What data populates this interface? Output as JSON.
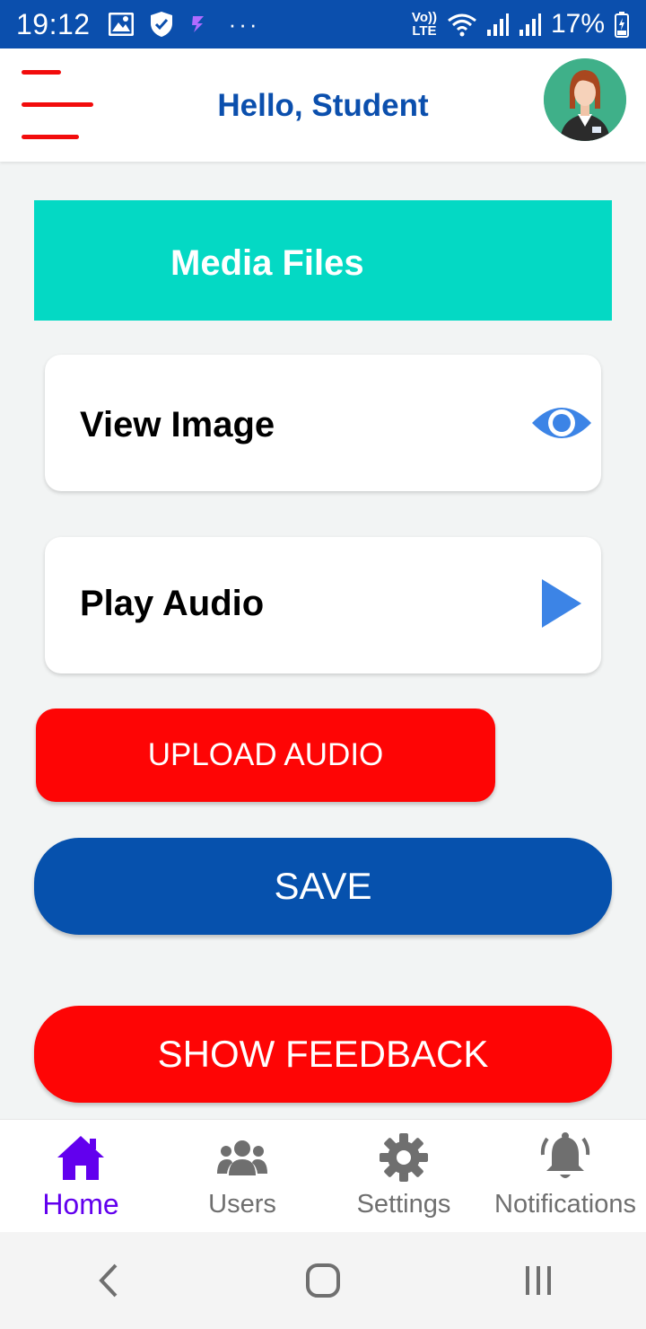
{
  "status_bar": {
    "time": "19:12",
    "network_label": "Vo)) LTE",
    "battery": "17%",
    "icons": [
      "image-icon",
      "shield-check-icon",
      "app-icon",
      "more-dots-icon",
      "wifi-icon",
      "signal-icon",
      "signal-icon",
      "battery-icon"
    ]
  },
  "header": {
    "title": "Hello, Student",
    "menu_icon": "hamburger-menu-icon",
    "avatar_icon": "student-avatar-icon",
    "accent_color": "#0b4fad"
  },
  "banner": {
    "label": "Media Files",
    "color": "#04d9c4"
  },
  "cards": [
    {
      "label": "View Image",
      "icon": "eye-icon"
    },
    {
      "label": "Play Audio",
      "icon": "play-icon"
    }
  ],
  "buttons": {
    "upload_audio": "UPLOAD AUDIO",
    "save": "SAVE",
    "show_feedback": "SHOW FEEDBACK"
  },
  "bottom_nav": {
    "items": [
      {
        "label": "Home",
        "icon": "home-icon",
        "active": true
      },
      {
        "label": "Users",
        "icon": "users-icon",
        "active": false
      },
      {
        "label": "Settings",
        "icon": "gear-icon",
        "active": false
      },
      {
        "label": "Notifications",
        "icon": "bell-icon",
        "active": false
      }
    ],
    "active_color": "#6200ee"
  },
  "system_nav": {
    "icons": [
      "back-icon",
      "home-circle-icon",
      "recents-icon"
    ]
  }
}
